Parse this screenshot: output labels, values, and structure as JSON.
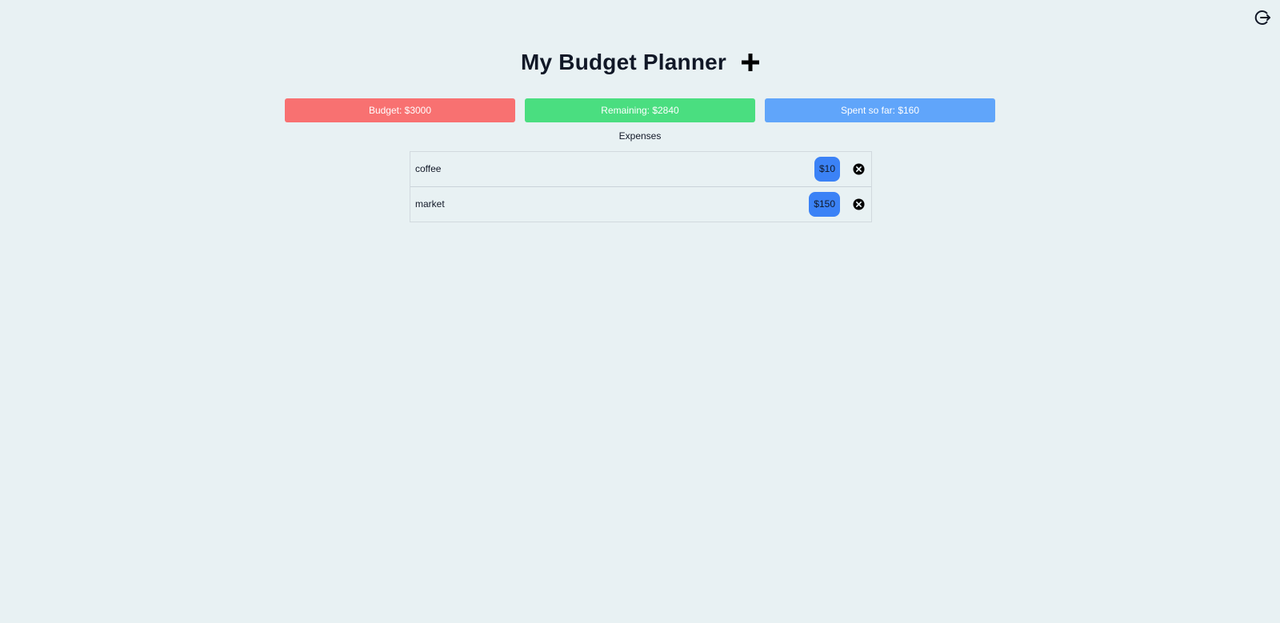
{
  "header": {
    "title": "My Budget Planner",
    "add_icon": "plus-icon",
    "logout_icon": "logout-icon"
  },
  "stats": {
    "budget": "Budget: $3000",
    "remaining": "Remaining: $2840",
    "spent": "Spent so far: $160"
  },
  "colors": {
    "budget": "#f87171",
    "remaining": "#4ade80",
    "spent": "#60a5fa",
    "amount_badge": "#3b82f6",
    "background": "#e8f1f3"
  },
  "expenses": {
    "heading": "Expenses",
    "items": [
      {
        "name": "coffee",
        "amount": "$10",
        "delete_icon": "close-circle-icon"
      },
      {
        "name": "market",
        "amount": "$150",
        "delete_icon": "close-circle-icon"
      }
    ]
  }
}
